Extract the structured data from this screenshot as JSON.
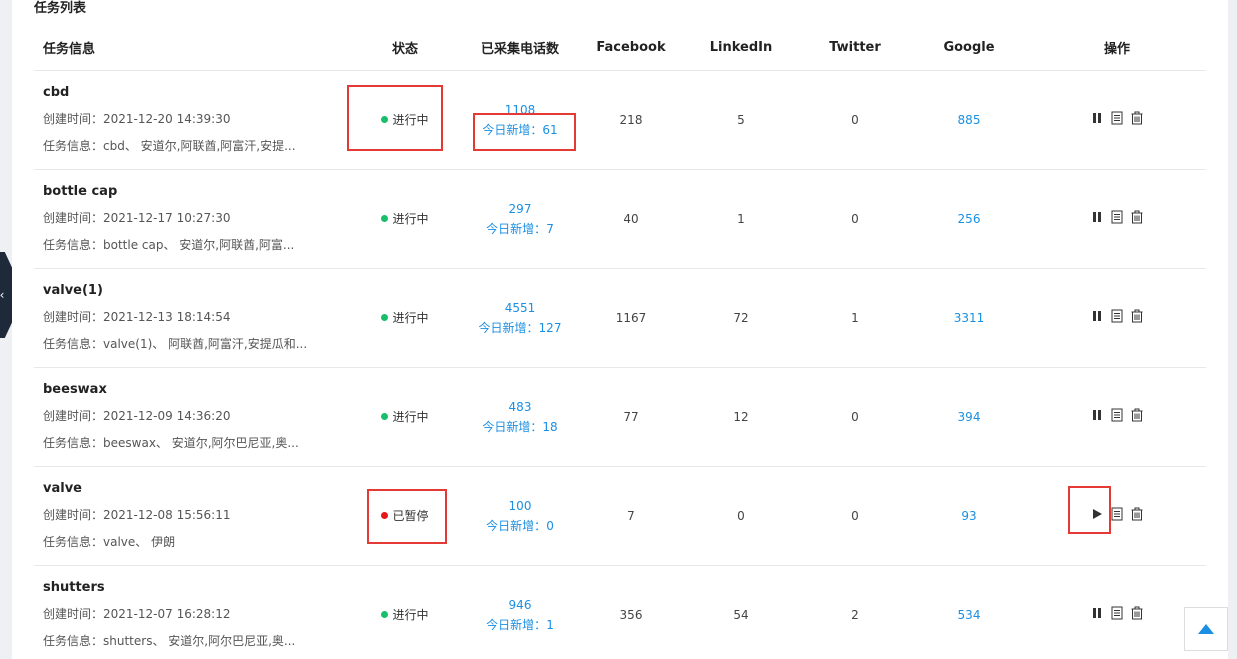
{
  "panel": {
    "title": "任务列表"
  },
  "columns": [
    "任务信息",
    "状态",
    "已采集电话数",
    "Facebook",
    "LinkedIn",
    "Twitter",
    "Google",
    "操作"
  ],
  "labels": {
    "created_prefix": "创建时间：",
    "info_prefix": "任务信息：",
    "today_prefix": "今日新增："
  },
  "colors": {
    "running": "#19be6b",
    "paused": "#e8161b",
    "link": "#1a8fe3",
    "highlight": "#e53935"
  },
  "rows": [
    {
      "name": "cbd",
      "created": "2021-12-20 14:39:30",
      "info": "cbd、 安道尔,阿联酋,阿富汗,安提...",
      "status": "进行中",
      "state": "running",
      "phones": "1108",
      "today": "61",
      "facebook": "218",
      "linkedin": "5",
      "twitter": "0",
      "google": "885",
      "action_icon": "pause-icon"
    },
    {
      "name": "bottle cap",
      "created": "2021-12-17 10:27:30",
      "info": "bottle cap、 安道尔,阿联酋,阿富...",
      "status": "进行中",
      "state": "running",
      "phones": "297",
      "today": "7",
      "facebook": "40",
      "linkedin": "1",
      "twitter": "0",
      "google": "256",
      "action_icon": "pause-icon"
    },
    {
      "name": "valve(1)",
      "created": "2021-12-13 18:14:54",
      "info": "valve(1)、 阿联酋,阿富汗,安提瓜和...",
      "status": "进行中",
      "state": "running",
      "phones": "4551",
      "today": "127",
      "facebook": "1167",
      "linkedin": "72",
      "twitter": "1",
      "google": "3311",
      "action_icon": "pause-icon"
    },
    {
      "name": "beeswax",
      "created": "2021-12-09 14:36:20",
      "info": "beeswax、 安道尔,阿尔巴尼亚,奥...",
      "status": "进行中",
      "state": "running",
      "phones": "483",
      "today": "18",
      "facebook": "77",
      "linkedin": "12",
      "twitter": "0",
      "google": "394",
      "action_icon": "pause-icon"
    },
    {
      "name": "valve",
      "created": "2021-12-08 15:56:11",
      "info": "valve、 伊朗",
      "status": "已暂停",
      "state": "paused",
      "phones": "100",
      "today": "0",
      "facebook": "7",
      "linkedin": "0",
      "twitter": "0",
      "google": "93",
      "action_icon": "play-icon"
    },
    {
      "name": "shutters",
      "created": "2021-12-07 16:28:12",
      "info": "shutters、 安道尔,阿尔巴尼亚,奥...",
      "status": "进行中",
      "state": "running",
      "phones": "946",
      "today": "1",
      "facebook": "356",
      "linkedin": "54",
      "twitter": "2",
      "google": "534",
      "action_icon": "pause-icon"
    }
  ]
}
